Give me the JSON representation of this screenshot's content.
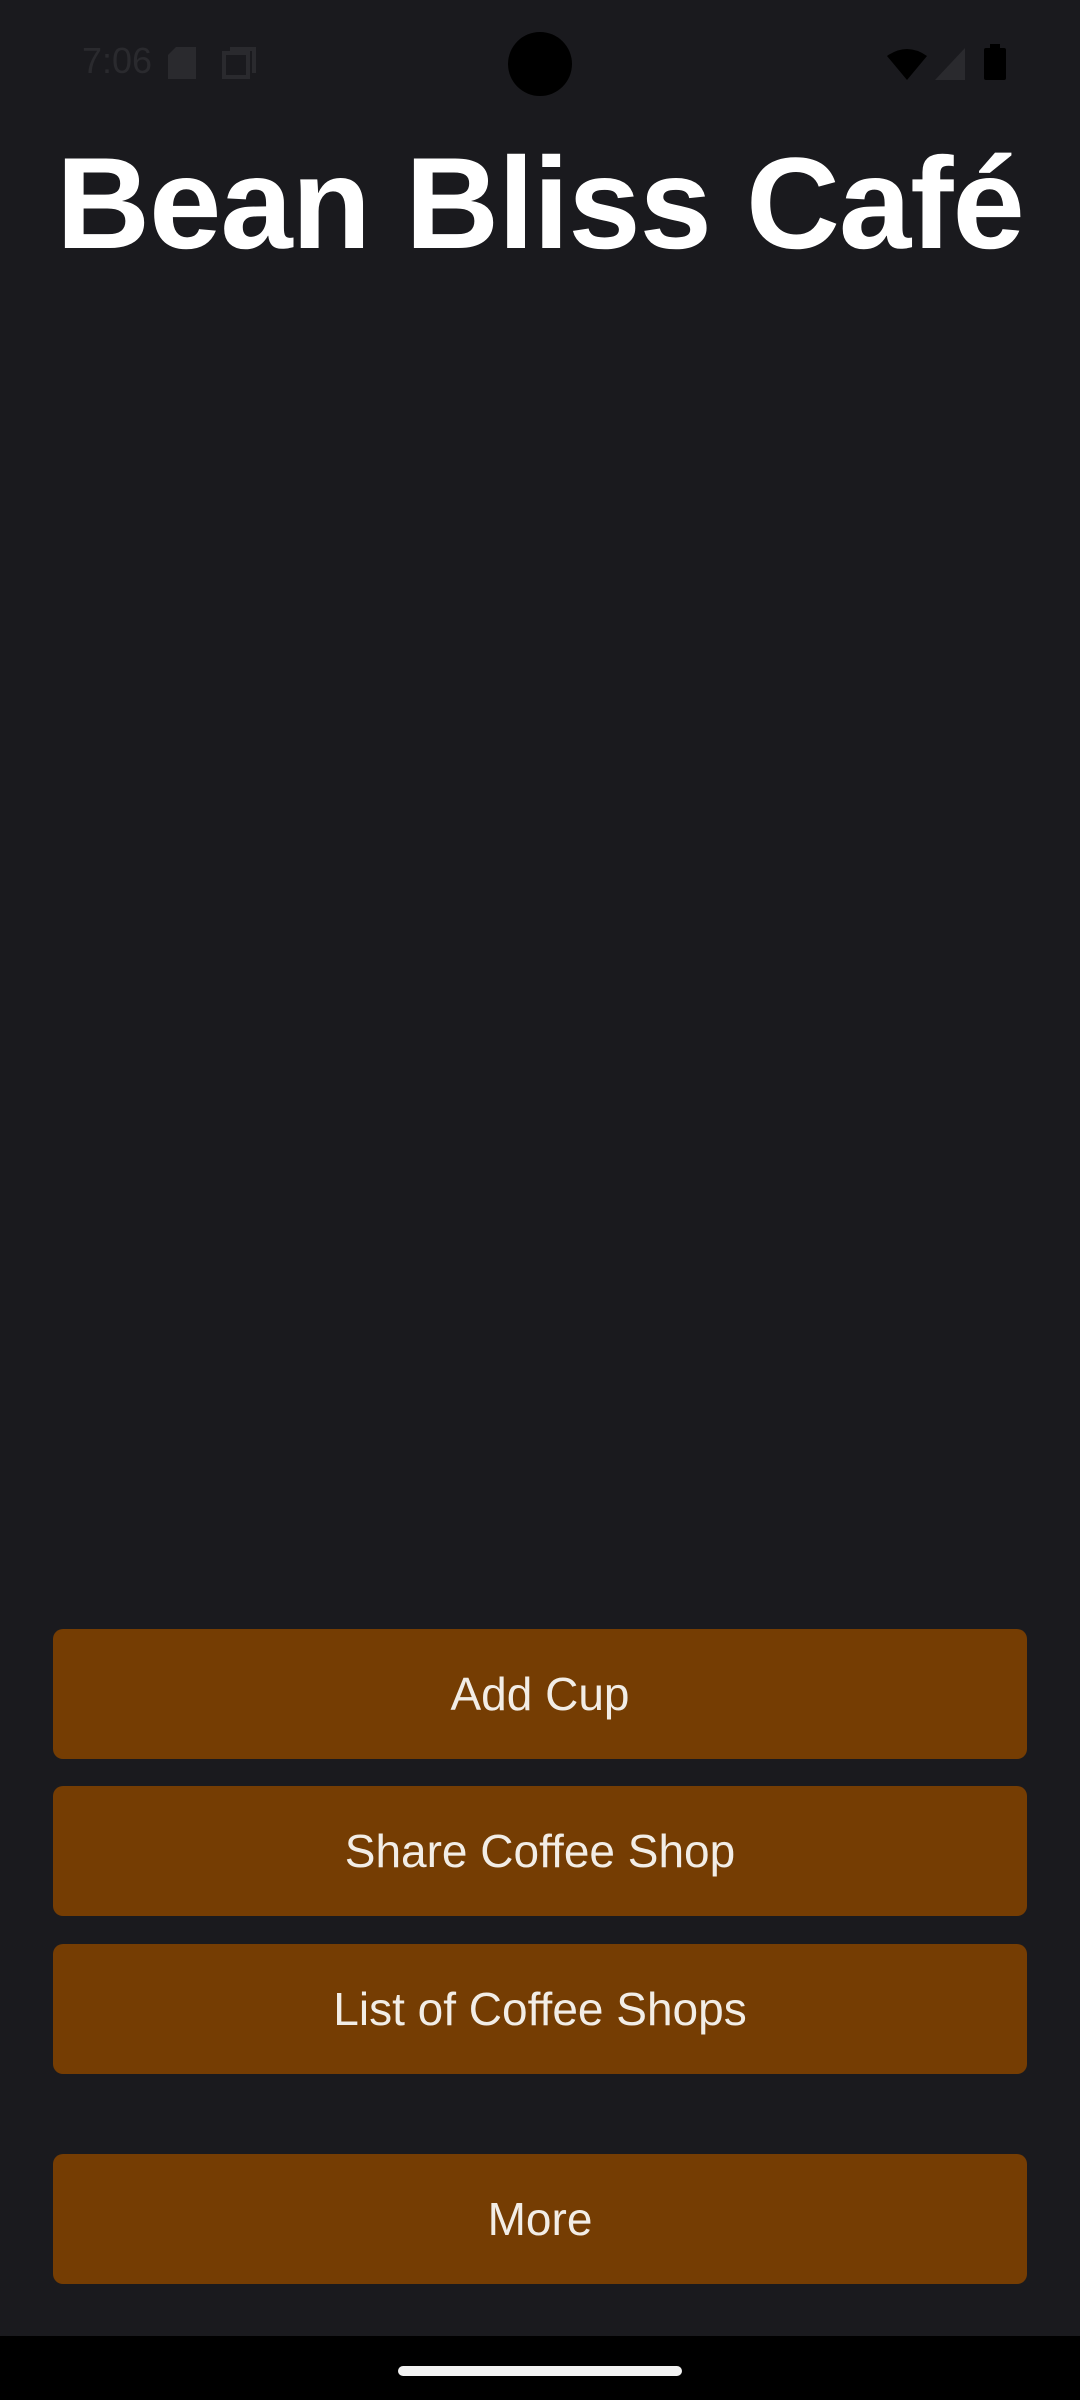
{
  "status_bar": {
    "time": "7:06",
    "icons": [
      "sd-card-icon",
      "screenshot-icon",
      "wifi-icon",
      "signal-icon",
      "battery-icon"
    ]
  },
  "app": {
    "title": "Bean Bliss Café"
  },
  "buttons": {
    "add_cup": "Add Cup",
    "share_shop": "Share Coffee Shop",
    "list_shops": "List of Coffee Shops",
    "more": "More"
  },
  "colors": {
    "background": "#1a1a1e",
    "button": "#753d03",
    "button_text": "#f2ede6",
    "title": "#ffffff"
  }
}
